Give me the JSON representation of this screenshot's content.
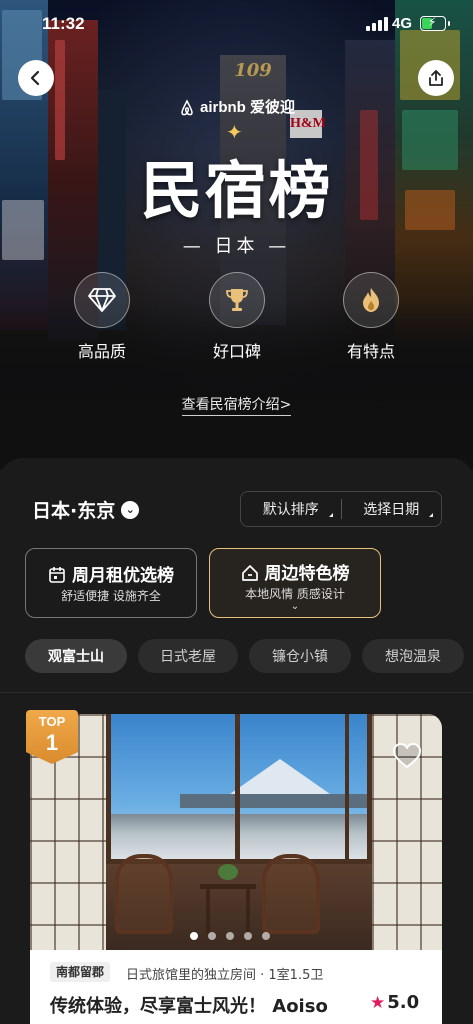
{
  "status_bar": {
    "time": "11:32",
    "network": "4G"
  },
  "hero": {
    "brand": "airbnb 爱彼迎",
    "title": "民宿榜",
    "subtitle": "— 日本 —",
    "tower_sign": "109",
    "store_sign": "H&M",
    "features": [
      {
        "icon": "diamond-icon",
        "label": "高品质"
      },
      {
        "icon": "trophy-icon",
        "label": "好口碑"
      },
      {
        "icon": "flame-icon",
        "label": "有特点"
      }
    ],
    "intro_link": "查看民宿榜介绍>"
  },
  "filters": {
    "location": "日本·东京",
    "sort_label": "默认排序",
    "date_label": "选择日期"
  },
  "list_cards": [
    {
      "title": "周月租优选榜",
      "desc": "舒适便捷 设施齐全",
      "selected": false
    },
    {
      "title": "周边特色榜",
      "desc": "本地风情 质感设计",
      "selected": true
    }
  ],
  "chips": [
    "观富士山",
    "日式老屋",
    "镰仓小镇",
    "想泡温泉"
  ],
  "listing": {
    "rank_label": "TOP",
    "rank": "1",
    "area_tag": "南都留郡",
    "room_type": "日式旅馆里的独立房间 · 1室1.5卫",
    "title": "传统体验，尽享富士风光！ Aoiso",
    "rating": "5.0",
    "photo_count": 5,
    "active_photo": 0
  },
  "colors": {
    "accent_gold": "#e8c07a",
    "badge_orange": "#e89a3a",
    "rating_star": "#e31c5f",
    "sheet_bg": "#1b1b1b"
  }
}
